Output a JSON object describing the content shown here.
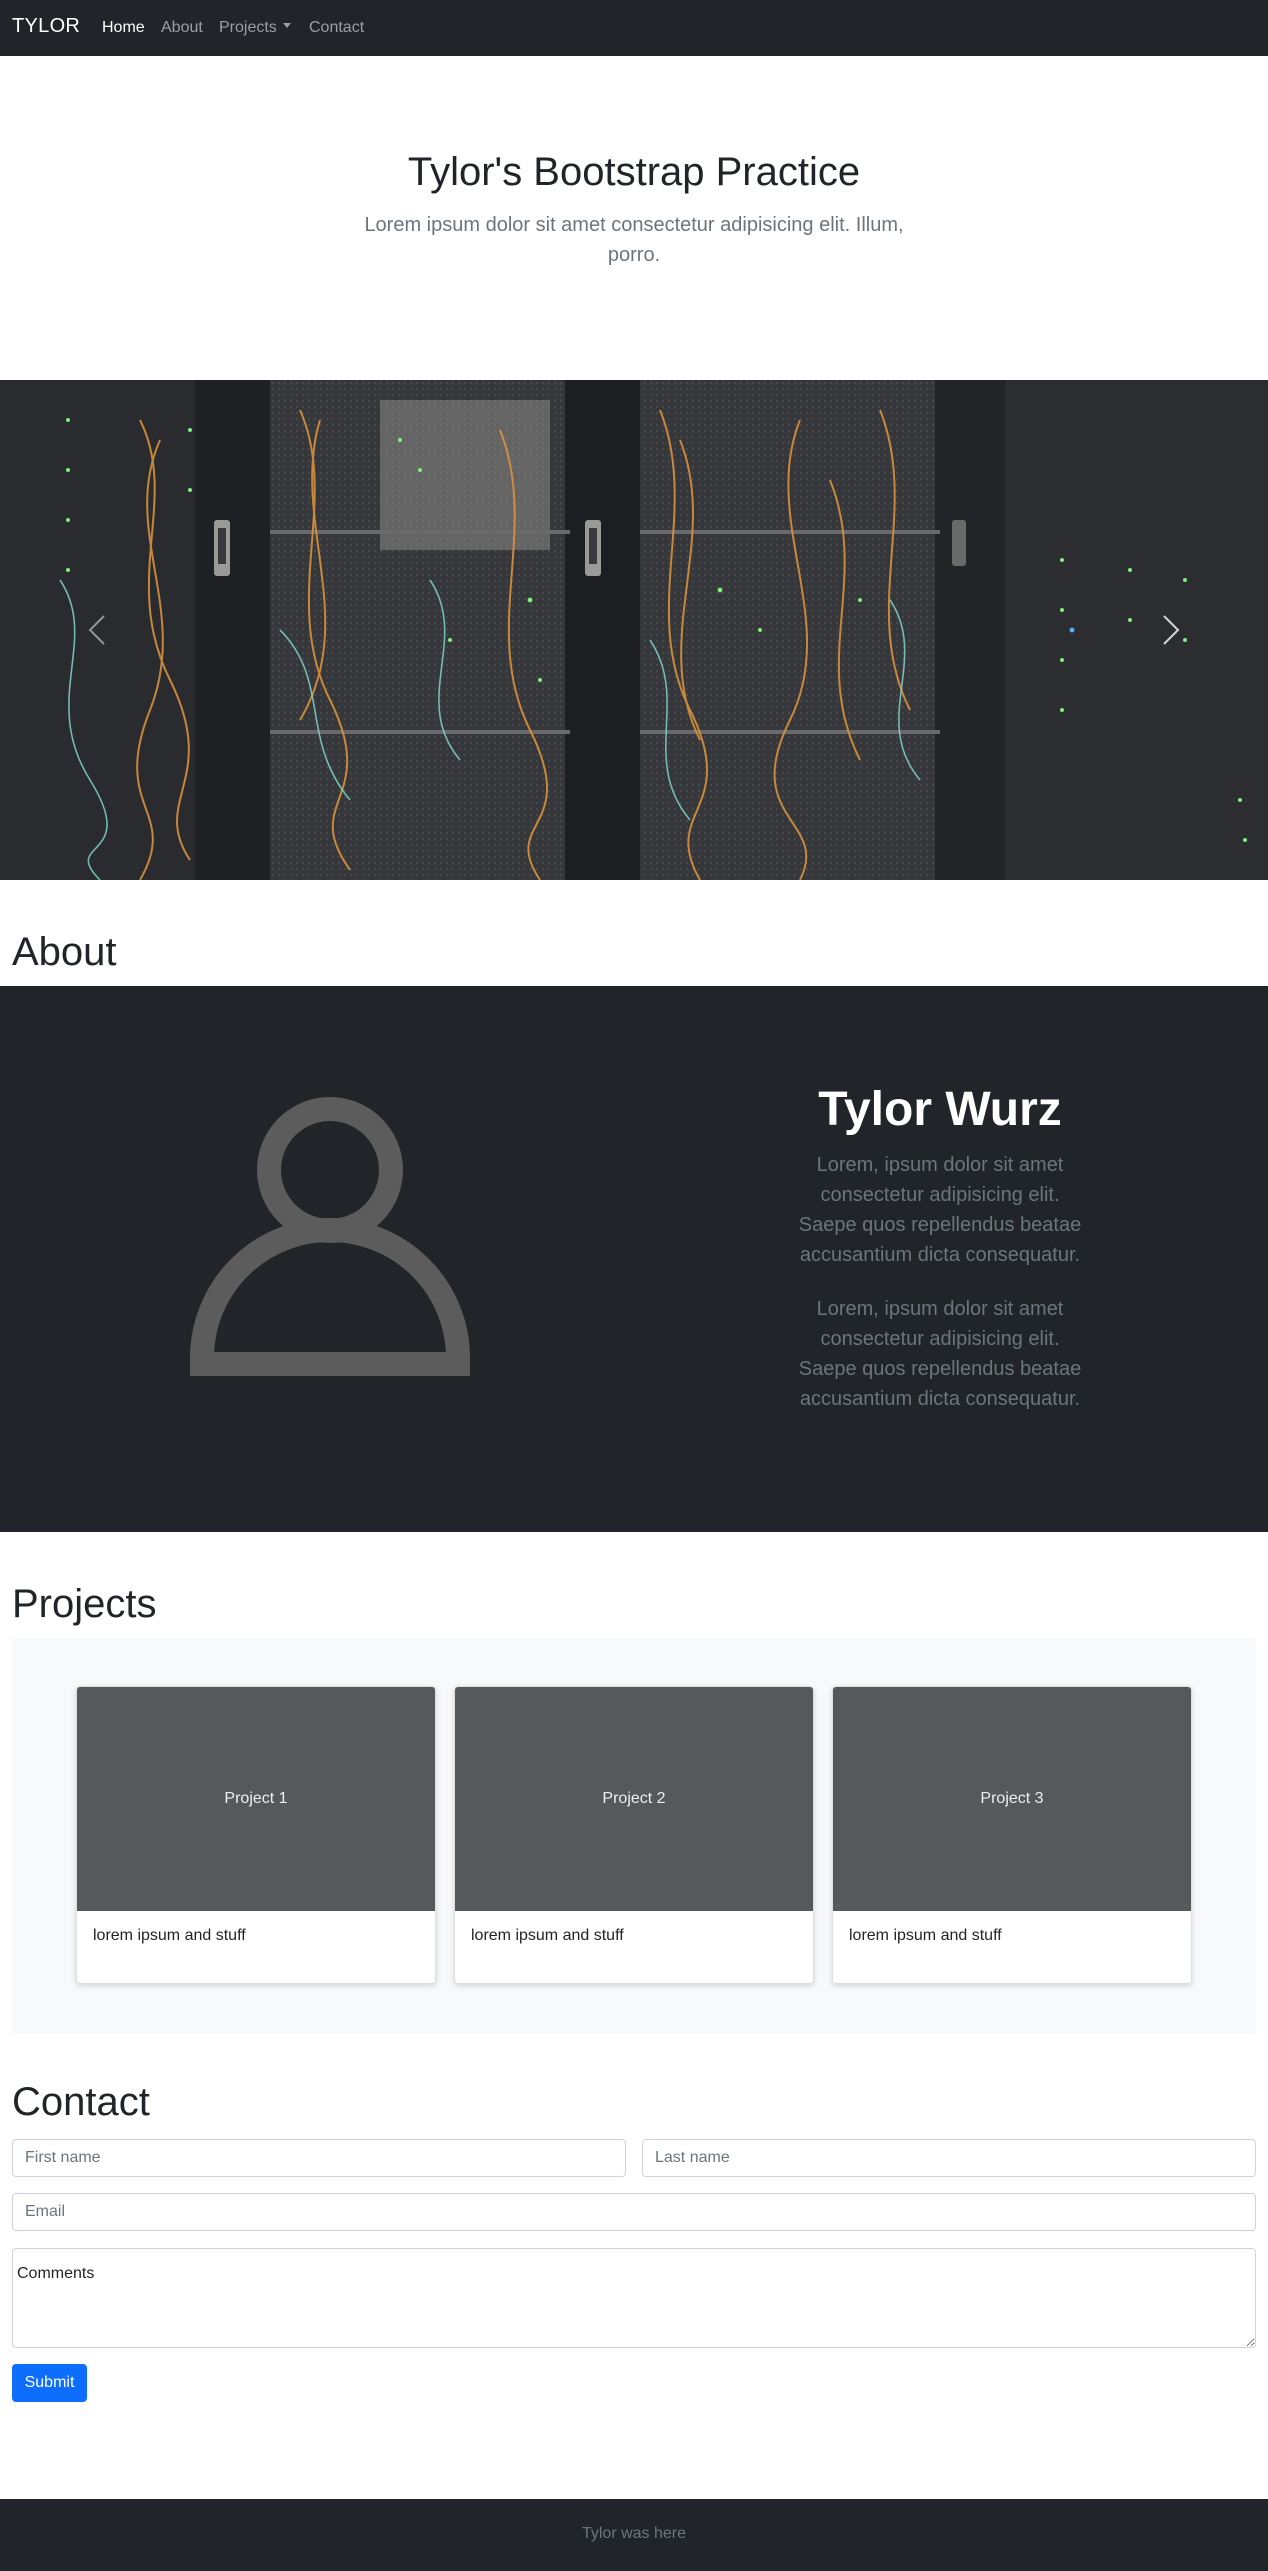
{
  "nav": {
    "brand": "TYLOR",
    "links": [
      "Home",
      "About",
      "Projects",
      "Contact"
    ],
    "active": "Home"
  },
  "hero": {
    "title": "Tylor's Bootstrap Practice",
    "lead": "Lorem ipsum dolor sit amet consectetur adipisicing elit. Illum, porro."
  },
  "carousel": {
    "image": "server-rack-cables-photo",
    "prev_icon": "chevron-left-icon",
    "next_icon": "chevron-right-icon"
  },
  "about": {
    "heading": "About",
    "avatar_icon": "person-icon",
    "name": "Tylor Wurz",
    "paragraphs": [
      "Lorem, ipsum dolor sit amet consectetur adipisicing elit. Saepe quos repellendus beatae accusantium dicta consequatur.",
      "Lorem, ipsum dolor sit amet consectetur adipisicing elit. Saepe quos repellendus beatae accusantium dicta consequatur."
    ]
  },
  "projects": {
    "heading": "Projects",
    "cards": [
      {
        "title": "Project 1",
        "text": "lorem ipsum and stuff"
      },
      {
        "title": "Project 2",
        "text": "lorem ipsum and stuff"
      },
      {
        "title": "Project 3",
        "text": "lorem ipsum and stuff"
      }
    ]
  },
  "contact": {
    "heading": "Contact",
    "first_name_placeholder": "First name",
    "last_name_placeholder": "Last name",
    "email_placeholder": "Email",
    "comments_placeholder": "Comments",
    "submit_label": "Submit"
  },
  "footer": {
    "text": "Tylor was here"
  },
  "colors": {
    "dark": "#212529",
    "muted": "#6c757d",
    "primary": "#0d6efd",
    "light": "#f8f9fa"
  }
}
